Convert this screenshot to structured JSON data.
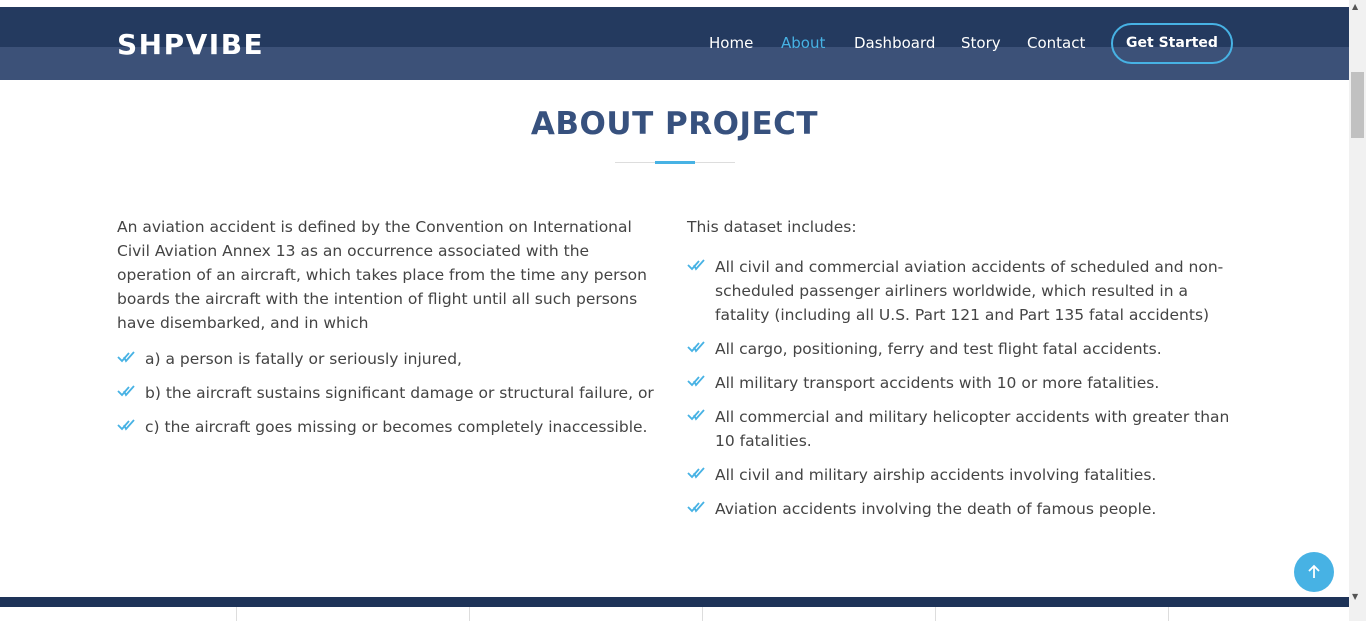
{
  "header": {
    "logo": "SHPVIBE",
    "nav": [
      "Home",
      "About",
      "Dashboard",
      "Story",
      "Contact"
    ],
    "active": "About",
    "cta": "Get Started"
  },
  "about": {
    "title": "ABOUT PROJECT",
    "left_intro": "An aviation accident is defined by the Convention on International Civil Aviation Annex 13 as an occurrence associated with the operation of an aircraft, which takes place from the time any person boards the aircraft with the intention of flight until all such persons have disembarked, and in which",
    "left_items": [
      "a) a person is fatally or seriously injured,",
      "b) the aircraft sustains significant damage or structural failure, or",
      "c) the aircraft goes missing or becomes completely inaccessible."
    ],
    "right_intro": "This dataset includes:",
    "right_items": [
      "All civil and commercial aviation accidents of scheduled and non-scheduled passenger airliners worldwide, which resulted in a fatality (including all U.S. Part 121 and Part 135 fatal accidents)",
      "All cargo, positioning, ferry and test flight fatal accidents.",
      "All military transport accidents with 10 or more fatalities.",
      "All commercial and military helicopter accidents with greater than 10 fatalities.",
      "All civil and military airship accidents involving fatalities.",
      "Aviation accidents involving the death of famous people."
    ]
  },
  "icons": {
    "check": "double-check-icon",
    "back_to_top": "arrow-up-icon"
  },
  "colors": {
    "header_bg": "#243a5f",
    "accent": "#47b2e4",
    "title": "#37517e"
  }
}
